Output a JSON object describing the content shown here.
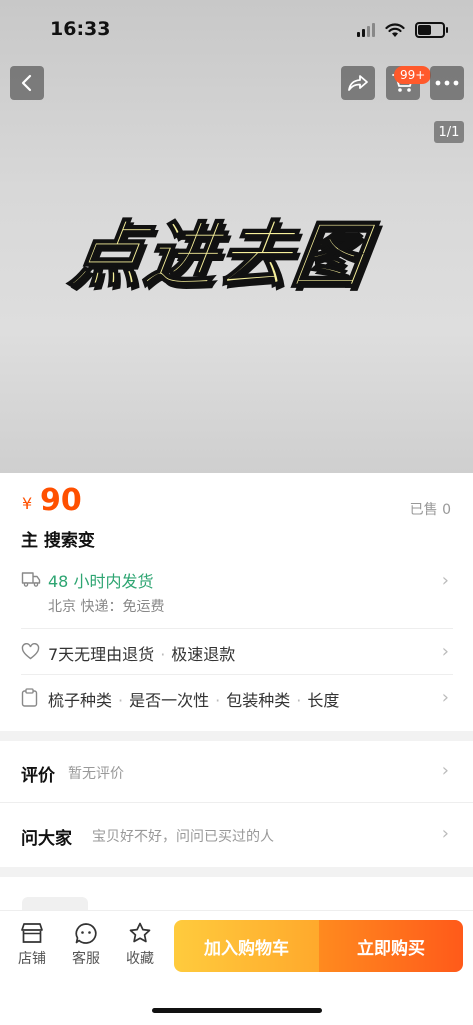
{
  "status": {
    "time": "16:33"
  },
  "header": {
    "cart_badge": "99+",
    "pager": "1/1",
    "hero_text": "点进去图"
  },
  "product": {
    "price_symbol": "¥",
    "price": "90",
    "sold": "已售 0",
    "title": "主 搜索变"
  },
  "shipping": {
    "headline": "48 小时内发货",
    "detail": "北京  快递：免运费"
  },
  "service": {
    "items": [
      "7天无理由退货",
      "极速退款"
    ]
  },
  "attributes": {
    "items": [
      "梳子种类",
      "是否一次性",
      "包装种类",
      "长度"
    ]
  },
  "reviews": {
    "title": "评价",
    "subtitle": "暂无评价"
  },
  "ask": {
    "title": "问大家",
    "subtitle": "宝贝好不好，问问已买过的人"
  },
  "bottom_bar": {
    "store": "店铺",
    "service": "客服",
    "favorite": "收藏",
    "add_to_cart": "加入购物车",
    "buy_now": "立即购买"
  },
  "colors": {
    "accent": "#ff5000",
    "shipping": "#2ea572"
  }
}
